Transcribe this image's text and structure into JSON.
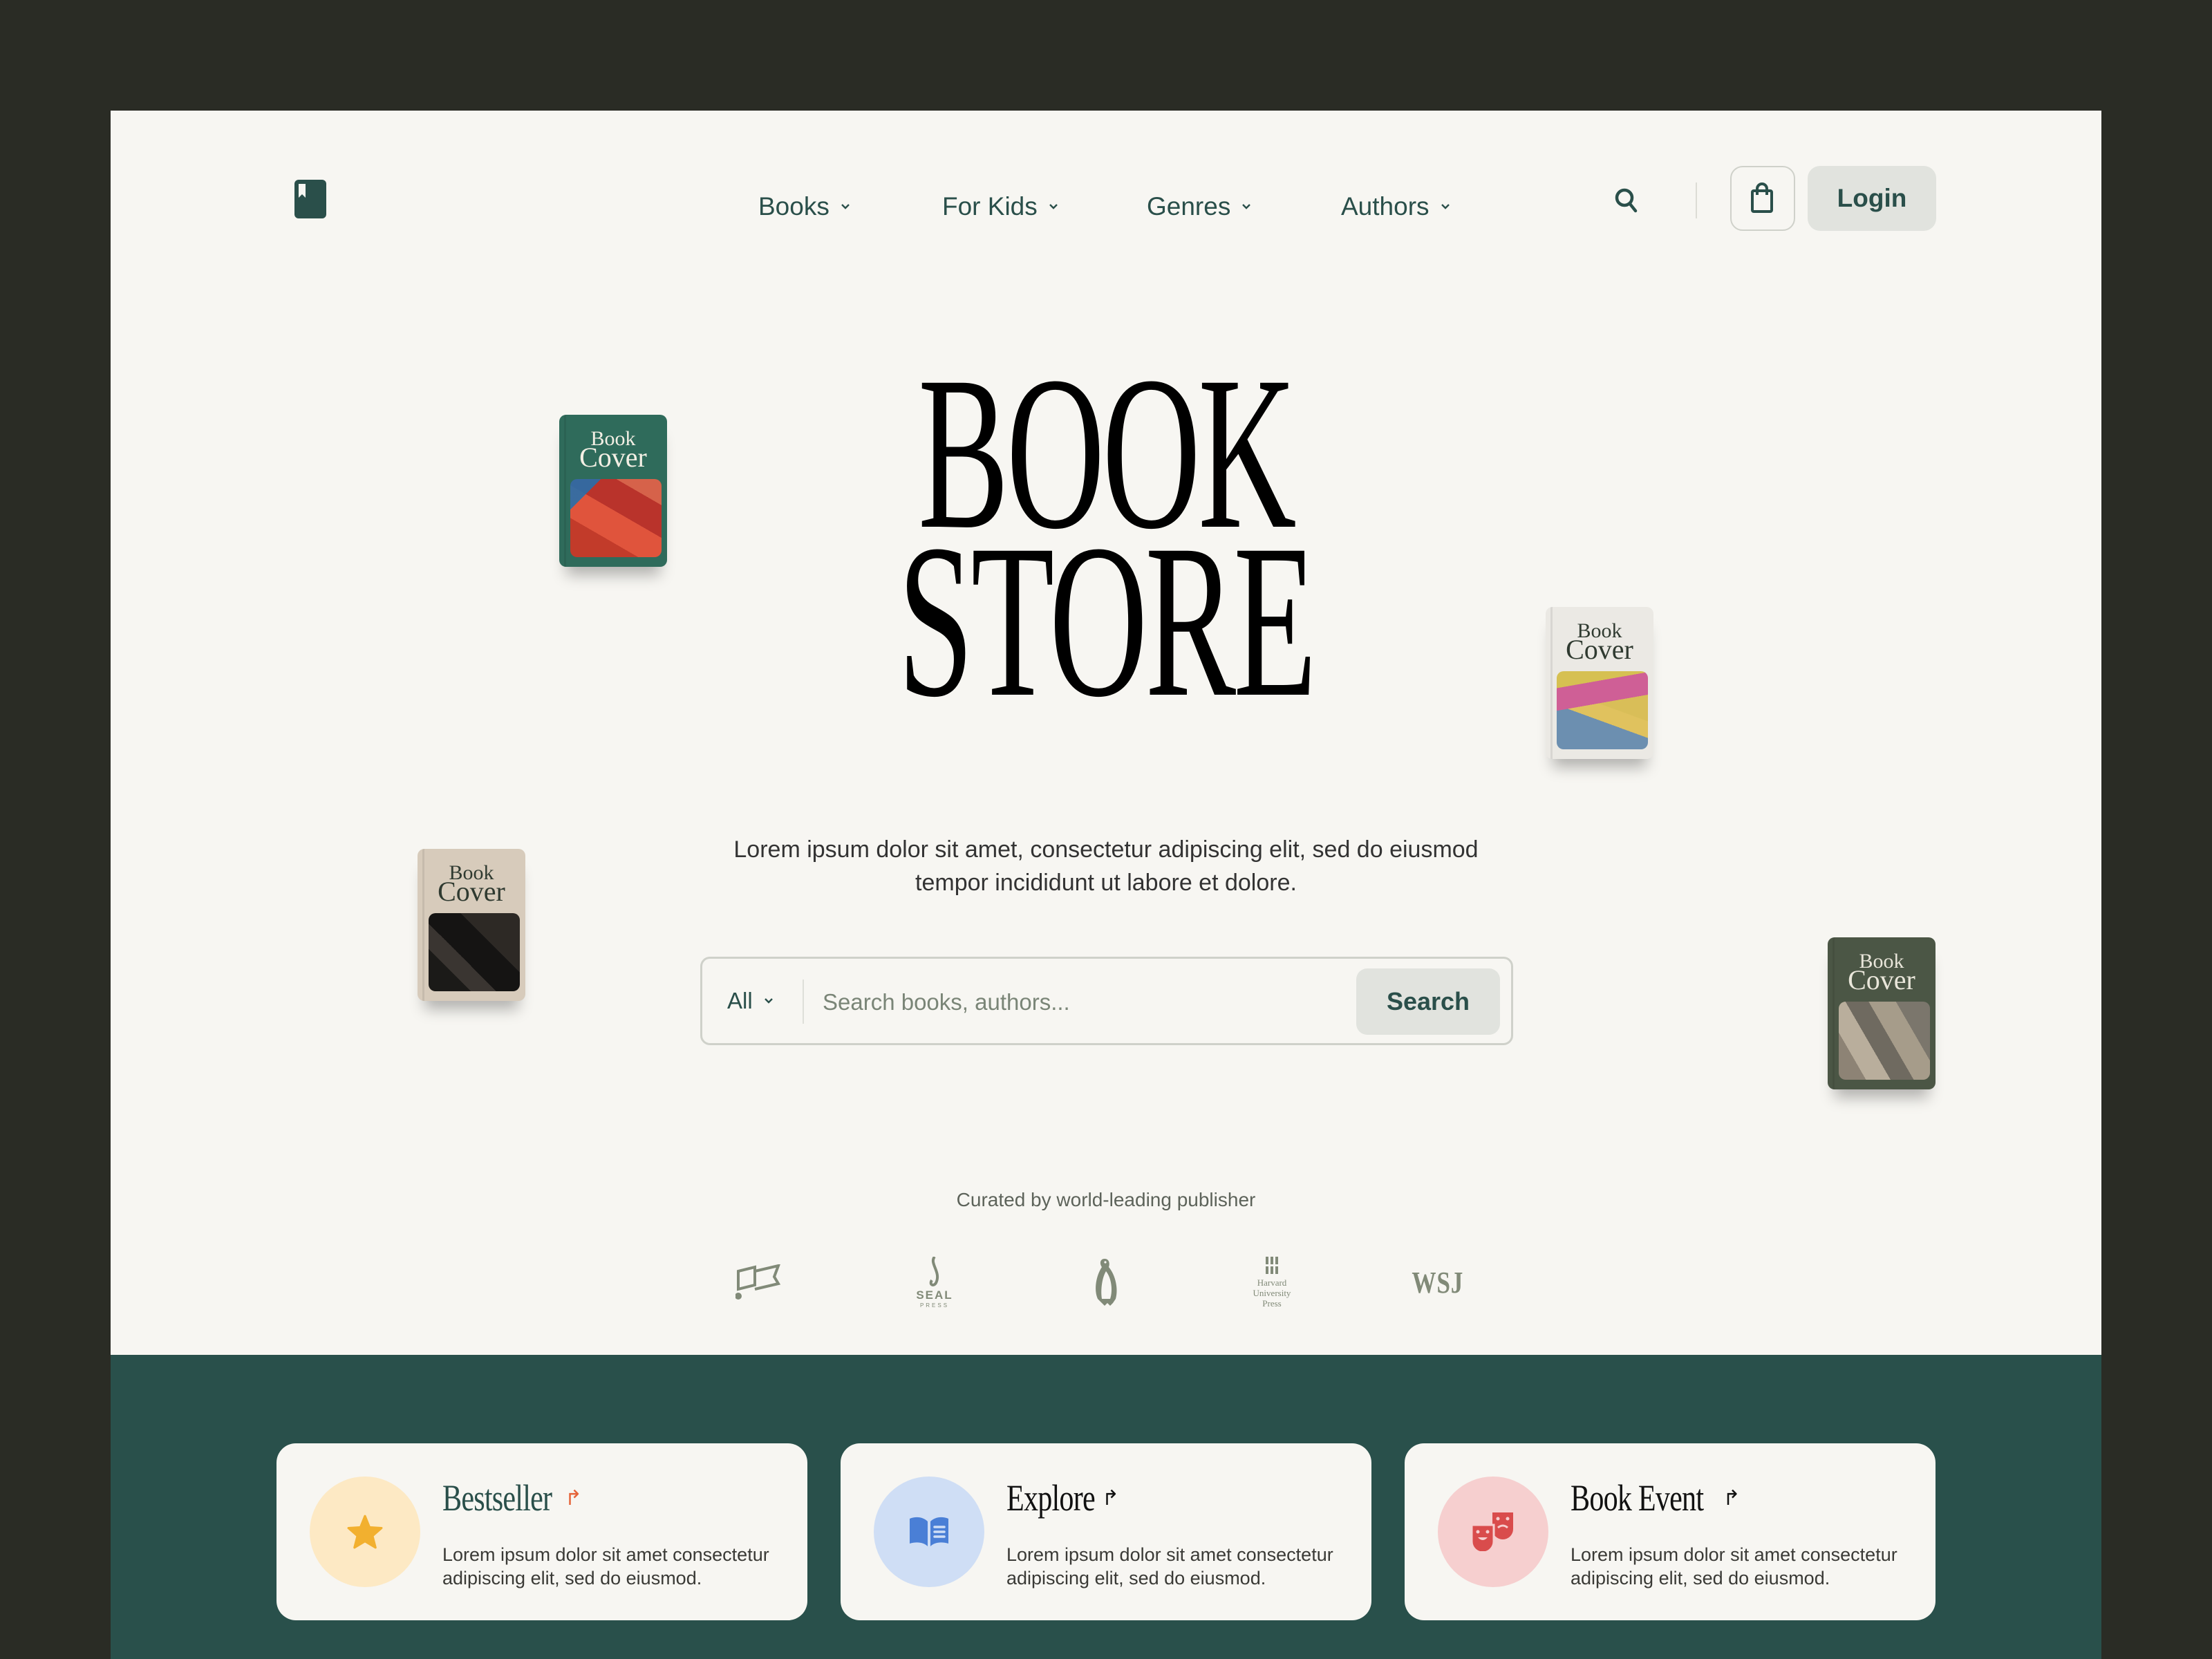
{
  "brand": {
    "logo_icon": "bookmark-book-icon"
  },
  "nav": {
    "items": [
      {
        "label": "Books",
        "icon": "chevron-down-icon"
      },
      {
        "label": "For Kids",
        "icon": "chevron-down-icon"
      },
      {
        "label": "Genres",
        "icon": "chevron-down-icon"
      },
      {
        "label": "Authors",
        "icon": "chevron-down-icon"
      }
    ],
    "search_icon": "search-icon",
    "cart_icon": "shopping-bag-icon",
    "login_label": "Login"
  },
  "hero": {
    "title_line1": "BOOK",
    "title_line2": "STORE",
    "subtitle": "Lorem ipsum dolor sit amet, consectetur adipiscing elit, sed do eiusmod tempor incididunt ut labore et dolore."
  },
  "search": {
    "category_selected": "All",
    "placeholder": "Search books, authors...",
    "value": "",
    "button_label": "Search"
  },
  "books": [
    {
      "title_line1": "Book",
      "title_line2": "Cover",
      "cover_color": "#2f6b5b",
      "text_color": "#f3efe4"
    },
    {
      "title_line1": "Book",
      "title_line2": "Cover",
      "cover_color": "#ebe9e4",
      "text_color": "#2f3a30"
    },
    {
      "title_line1": "Book",
      "title_line2": "Cover",
      "cover_color": "#d7cbbb",
      "text_color": "#2f3a30"
    },
    {
      "title_line1": "Book",
      "title_line2": "Cover",
      "cover_color": "#4b5645",
      "text_color": "#e9e6da"
    }
  ],
  "publishers": {
    "heading": "Curated by world-leading publisher",
    "logos": [
      {
        "name": "flag-publisher-logo"
      },
      {
        "name": "seal-press-logo",
        "text1": "SEAL",
        "text2": "PRESS"
      },
      {
        "name": "penguin-logo"
      },
      {
        "name": "harvard-university-press-logo",
        "text1": "Harvard",
        "text2": "University",
        "text3": "Press"
      },
      {
        "name": "wsj-logo",
        "text1": "WSJ"
      }
    ]
  },
  "features": [
    {
      "title": "Bestseller",
      "arrow": "↱",
      "description": "Lorem ipsum dolor sit amet consectetur adipiscing elit, sed do eiusmod.",
      "icon": "star-icon",
      "circle_color": "#fde9c4",
      "icon_color": "#f2b02f",
      "title_color": "#2a4f4a",
      "arrow_color": "#e5643a"
    },
    {
      "title": "Explore",
      "arrow": "↱",
      "description": "Lorem ipsum dolor sit amet consectetur adipiscing elit, sed do eiusmod.",
      "icon": "open-book-icon",
      "circle_color": "#cfdef5",
      "icon_color": "#4a7fd6",
      "title_color": "#111111",
      "arrow_color": "#111111"
    },
    {
      "title": "Book Event",
      "arrow": "↱",
      "description": "Lorem ipsum dolor sit amet consectetur adipiscing elit, sed do eiusmod.",
      "icon": "theater-masks-icon",
      "circle_color": "#f6cfcf",
      "icon_color": "#d94c4c",
      "title_color": "#111111",
      "arrow_color": "#111111"
    }
  ],
  "colors": {
    "outer_bg": "#2a2c25",
    "page_bg": "#f7f6f2",
    "primary": "#2a4f4a",
    "band_bg": "#29504b",
    "muted_button": "#e1e3de"
  }
}
